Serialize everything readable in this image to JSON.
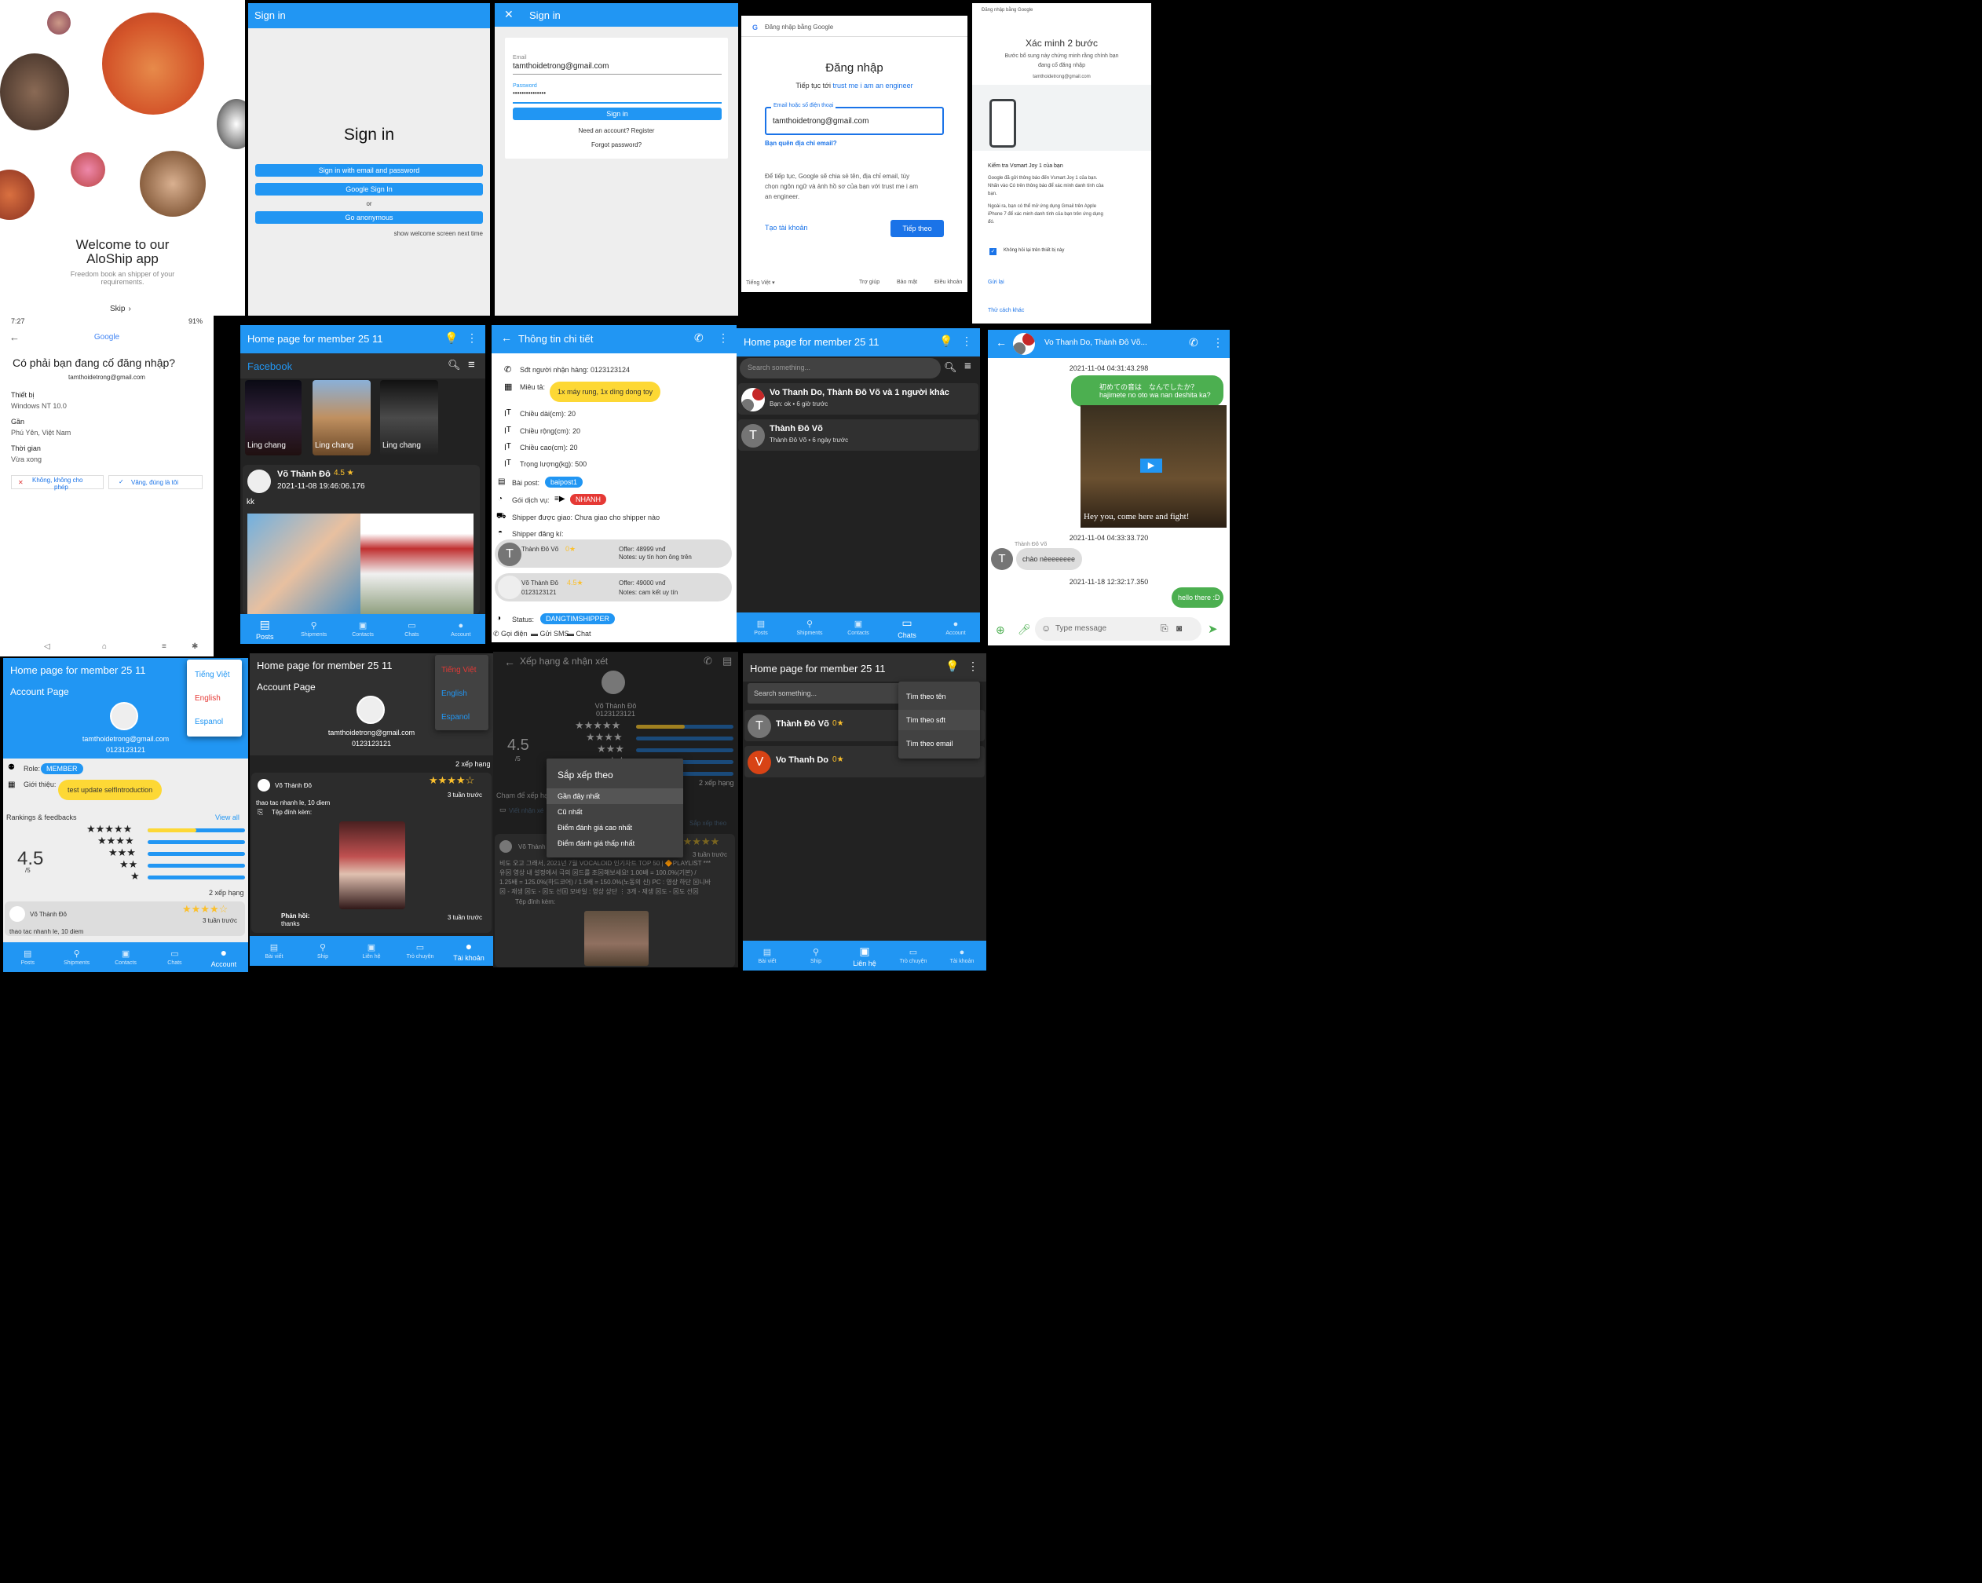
{
  "p1": {
    "title": "Welcome to our",
    "title2": "AloShip app",
    "sub": "Freedom book an shipper of your",
    "sub2": "requirements.",
    "skip": "Skip"
  },
  "p2": {
    "header": "Sign in",
    "heading": "Sign in",
    "btn_email": "Sign in with email and password",
    "btn_google": "Google Sign In",
    "or": "or",
    "btn_anon": "Go anonymous",
    "next": "show welcome screen next time"
  },
  "p3": {
    "header": "Sign in",
    "email_label": "Email",
    "email": "tamthoidetrong@gmail.com",
    "pw_label": "Password",
    "pw": "•••••••••••••••",
    "btn": "Sign in",
    "register": "Need an account? Register",
    "forgot": "Forgot password?"
  },
  "p4": {
    "bar": "Đăng nhập bằng Google",
    "title": "Đăng nhập",
    "continue": "Tiếp tục tới",
    "app": "trust me i am an engineer",
    "field_label": "Email hoặc số điện thoại",
    "field": "tamthoidetrong@gmail.com",
    "forgot": "Bạn quên địa chỉ email?",
    "info": "Để tiếp tục, Google sẽ chia sẻ tên, địa chỉ email, tùy",
    "info2": "chọn ngôn ngữ và ảnh hồ sơ của bạn với trust me i am",
    "info3": "an engineer.",
    "create": "Tạo tài khoản",
    "next": "Tiếp theo",
    "lang": "Tiếng Việt",
    "help": "Trợ giúp",
    "privacy": "Bảo mật",
    "terms": "Điều khoản"
  },
  "p5": {
    "bar": "Đăng nhập bằng Google",
    "title": "Xác minh 2 bước",
    "desc": "Bước bổ sung này chứng minh rằng chính bạn",
    "desc2": "đang cố đăng nhập",
    "email": "tamthoidetrong@gmail.com",
    "check": "Kiểm tra Vsmart Joy 1 của bạn",
    "p1": "Google đã gửi thông báo đến Vsmart Joy 1 của bạn.",
    "p1b": "Nhấn vào Có trên thông báo để xác minh danh tính của",
    "p1c": "bạn.",
    "p2": "Ngoài ra, bạn có thể mở ứng dụng Gmail trên Apple",
    "p2b": "iPhone 7 để xác minh danh tính của bạn trên ứng dụng",
    "p2c": "đó.",
    "dont": "Không hỏi lại trên thiết bị này",
    "resend": "Gửi lại",
    "other": "Thử cách khác"
  },
  "p6": {
    "time": "7:27",
    "battery": "91%",
    "google": "Google",
    "q": "Có phải bạn đang cố đăng nhập?",
    "email": "tamthoidetrong@gmail.com",
    "device_l": "Thiết bị",
    "device": "Windows NT 10.0",
    "near_l": "Gần",
    "near": "Phú Yên, Việt Nam",
    "time_l": "Thời gian",
    "time_v": "Vừa xong",
    "no": "Không, không cho",
    "no2": "phép",
    "yes": "Vâng, đúng là tôi"
  },
  "home": {
    "title": "Home page for member 25 11",
    "facebook": "Facebook",
    "story": "Ling chang",
    "poster": "Võ Thành Đô",
    "rating": "4.5",
    "date": "2021-11-08 19:46:06.176",
    "content": "kk",
    "search": "Search something...",
    "search_vi": "Search something..."
  },
  "nav_en": [
    "Posts",
    "Shipments",
    "Contacts",
    "Chats",
    "Account"
  ],
  "nav_vi": [
    "Bài viết",
    "Ship",
    "Liên hệ",
    "Trò chuyện",
    "Tài khoản"
  ],
  "detail": {
    "title": "Thông tin chi tiết",
    "phone": "Sđt người nhận hàng: 0123123124",
    "desc_l": "Miêu tả:",
    "desc": "1x máy rung, 1x dìng dong toy",
    "len": "Chiều dài(cm): 20",
    "wid": "Chiều rộng(cm): 20",
    "hei": "Chiều cao(cm): 20",
    "wei": "Trọng lượng(kg): 500",
    "post_l": "Bài post:",
    "post": "baipost1",
    "svc_l": "Gói dịch vụ:",
    "svc": "NHANH",
    "shipper_assigned": "Shipper được giao: Chưa giao cho shipper nào",
    "shipper_reg": "Shipper đăng kí:",
    "o1_name": "Thành Đô Võ",
    "o1_rate": "0",
    "o1_offer": "Offer: 48999 vnđ",
    "o1_notes": "Notes: uy tín hơn ông trên",
    "o2_name": "Võ Thành Đô",
    "o2_rate": "4.5",
    "o2_phone": "0123123121",
    "o2_offer": "Offer: 49000 vnđ",
    "o2_notes": "Notes: cam kết uy tín",
    "status_l": "Status:",
    "status": "DANGTIMSHIPPER",
    "call": "Gọi điện",
    "sms": "Gửi SMS",
    "chat": "Chat"
  },
  "chats": {
    "c1": "Vo Thanh Do, Thành Đô Võ và 1 người khác",
    "c1s": "Bạn: ok • 6 giờ trước",
    "c2": "Thành Đô Võ",
    "c2s": "Thành Đô Võ • 6 ngày trước"
  },
  "conv": {
    "title": "Vo Thanh Do, Thành Đô Võ...",
    "t1": "2021-11-04 04:31:43.298",
    "m1": "初めての音は　なんでしたか？",
    "m1b": "hajimete no oto wa nan deshita ka?",
    "sub": "Hey you, come here and fight!",
    "t2": "2021-11-04 04:33:33.720",
    "sender": "Thành Đô Võ",
    "m2": "chào nèeeeeeee",
    "t3": "2021-11-18 12:32:17.350",
    "m3": "hello there :D",
    "input": "Type message"
  },
  "acc": {
    "title": "Home page for member 25 11",
    "page": "Account Page",
    "email": "tamthoidetrong@gmail.com",
    "phone": "0123123121",
    "role_l": "Role:",
    "role": "MEMBER",
    "intro_l": "Giới thiệu:",
    "intro": "test update selfIntroduction",
    "rankings": "Rankings & feedbacks",
    "viewall": "View all",
    "score": "4.5",
    "outof": "/5",
    "count": "2 xếp hạng",
    "fb_name": "Võ Thành Đô",
    "fb_time": "3 tuần trước",
    "fb_text": "thao tac nhanh le, 10 diem",
    "lang1": "Tiếng Việt",
    "lang2": "English",
    "lang3": "Espanol"
  },
  "acc2": {
    "count": "2 xếp hạng",
    "name": "Võ Thành Đô",
    "time": "3 tuần trước",
    "text": "thao tac nhanh le, 10 diem",
    "attach": "Tệp đính kèm:",
    "reply_l": "Phản hồi:",
    "reply": "thanks",
    "reply_time": "3 tuần trước"
  },
  "rate": {
    "title": "Xếp hạng & nhận xét",
    "name": "Võ Thành Đô",
    "phone": "0123123121",
    "score": "4.5",
    "outof": "/5",
    "count": "2 xếp hạng",
    "touch": "Chạm để xếp hạ",
    "write": "Viết nhận xé",
    "sort_label": "Sắp xếp theo",
    "sort_title": "Sắp xếp theo",
    "opt1": "Gần đây nhất",
    "opt2": "Cũ nhất",
    "opt3": "Điểm đánh giá cao nhất",
    "opt4": "Điểm đánh giá thấp nhất",
    "fb": "Võ Thành",
    "time": "3 tuần trước",
    "long": "비도 오고 그래서, 2021년 7월 VOCALOID 인기차트 TOP 50 | 🔶PLAYLIST ***",
    "long2": "유⊠ 영상 내 설정에서 극의 ⊠드를 조⊠해보세요! 1.00배 = 100.0%(기본) /",
    "long3": "1.25배 = 125.0%(하드코어) / 1.5배 = 150.0%(노동의 신) PC : 영상 하단 ⊠니바",
    "long4": "⊠ - 재생 ⊠도 - ⊠도 선⊠ 모바일 : 영상 상단 ⋮ 3개 - 재생 ⊠도 - ⊠도 선⊠",
    "attach": "Tệp đính kèm:"
  },
  "contacts": {
    "search": "Search something...",
    "m1": "Tìm theo tên",
    "m2": "Tìm theo sđt",
    "m3": "Tìm theo email",
    "c1": "Thành Đô Võ",
    "c1r": "0",
    "c2": "Vo Thanh Do",
    "c2r": "0"
  },
  "colors": {
    "blue": "#2196f3",
    "yellow": "#fdd835",
    "red": "#e53935",
    "dark": "#303030"
  }
}
